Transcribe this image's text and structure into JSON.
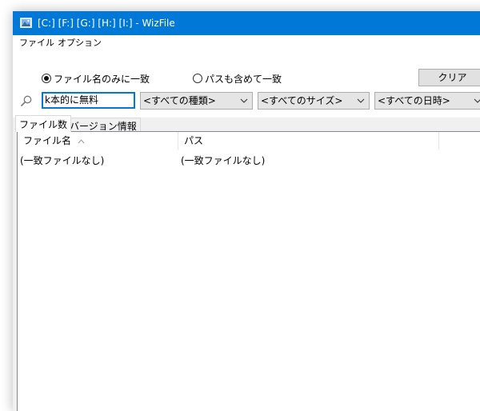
{
  "window": {
    "title": "[C:] [F:] [G:] [H:] [I:]  - WizFile",
    "icon": "wizfile-app-icon",
    "title_bar_color": "#0078d7"
  },
  "menu": {
    "items": [
      {
        "label": "ファイル"
      },
      {
        "label": "オプション"
      }
    ]
  },
  "options": {
    "radio_name_only": {
      "label": "ファイル名のみに一致",
      "selected": true
    },
    "radio_include_path": {
      "label": "パスも含めて一致",
      "selected": false
    },
    "clear_label": "クリア"
  },
  "search": {
    "icon": "search-icon",
    "value": "k本的に無料"
  },
  "filters": {
    "type": "<すべての種類>",
    "size": "<すべてのサイズ>",
    "date": "<すべての日時>"
  },
  "tabs": [
    {
      "label": "ファイル数",
      "active": true
    },
    {
      "label": "バージョン情報",
      "active": false
    }
  ],
  "table": {
    "columns": [
      {
        "label": "ファイル名",
        "sort": "ascending"
      },
      {
        "label": "パス"
      }
    ],
    "rows": [
      [
        "(一致ファイルなし)",
        "(一致ファイルなし)"
      ]
    ]
  },
  "colors": {
    "accent": "#0078d7",
    "window_bg": "#f0f0f0",
    "button_bg": "#e1e1e1"
  }
}
